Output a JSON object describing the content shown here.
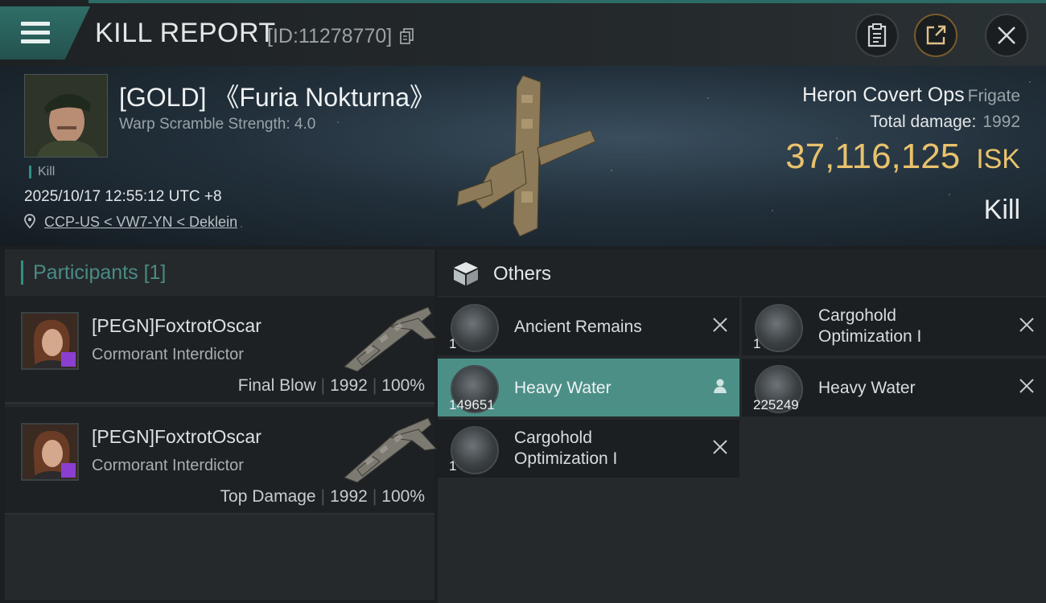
{
  "header": {
    "title": "KILL REPORT",
    "report_id": "[ID:11278770]"
  },
  "victim": {
    "name": "[GOLD] 《Furia Nokturna》",
    "scramble": "Warp Scramble Strength: 4.0",
    "kill_tag": "Kill",
    "time": "2025/10/17 12:55:12 UTC +8",
    "location": "CCP-US < VW7-YN < Deklein",
    "ship_name": "Heron Covert Ops",
    "ship_class": "Frigate",
    "total_damage_label": "Total damage:",
    "total_damage": "1992",
    "isk_value": "37,116,125",
    "isk_unit": "ISK",
    "result": "Kill"
  },
  "participants": {
    "label": "Participants",
    "count": "[1]",
    "list": [
      {
        "name": "[PEGN]FoxtrotOscar",
        "ship": "Cormorant Interdictor",
        "role": "Final Blow",
        "damage": "1992",
        "percent": "100%"
      },
      {
        "name": "[PEGN]FoxtrotOscar",
        "ship": "Cormorant Interdictor",
        "role": "Top Damage",
        "damage": "1992",
        "percent": "100%"
      }
    ]
  },
  "others": {
    "title": "Others",
    "items": [
      {
        "name_line1": "Ancient Remains",
        "name_line2": "",
        "qty": "1",
        "action": "close-icon"
      },
      {
        "name_line1": "Cargohold",
        "name_line2": "Optimization I",
        "qty": "1",
        "action": "close-icon"
      },
      {
        "name_line1": "Heavy Water",
        "name_line2": "",
        "qty": "149651",
        "action": "person-icon"
      },
      {
        "name_line1": "Heavy Water",
        "name_line2": "",
        "qty": "225249",
        "action": "close-icon"
      },
      {
        "name_line1": "Cargohold",
        "name_line2": "Optimization I",
        "qty": "1",
        "action": "close-icon"
      }
    ]
  },
  "colors": {
    "accent": "#4c8f87",
    "isk": "#e9c26c",
    "participant_header": "#4a8b84",
    "pilot_badge": "#8a3fd1"
  }
}
